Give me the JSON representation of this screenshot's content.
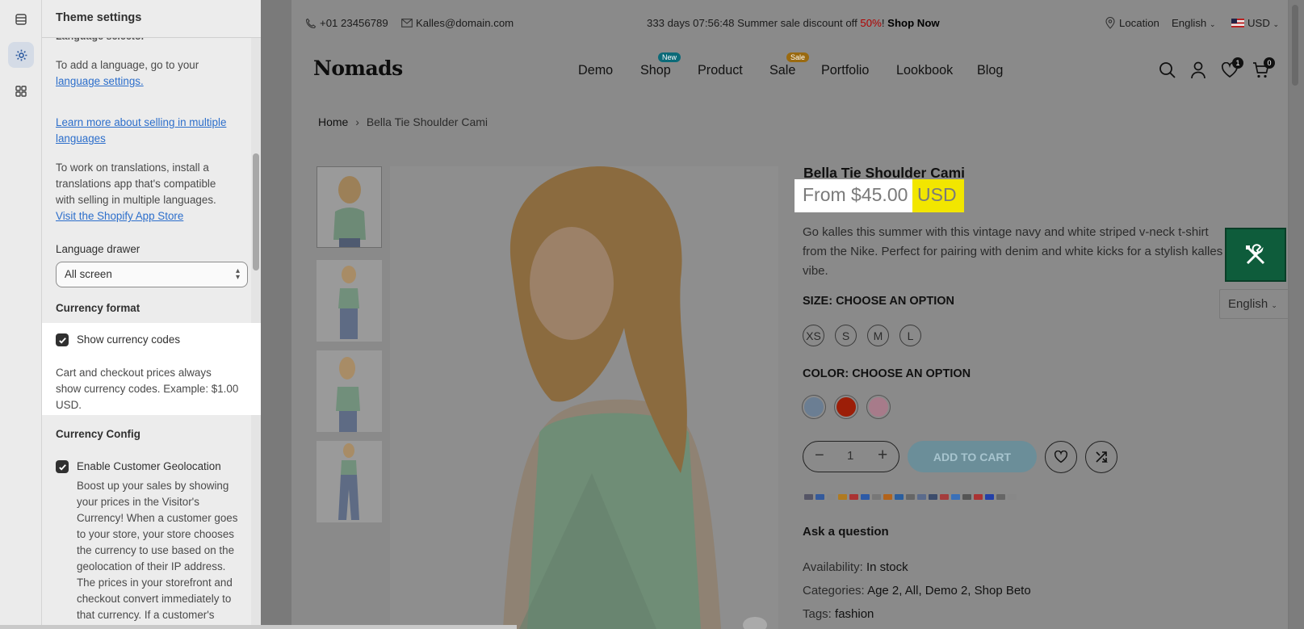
{
  "sidebar": {
    "title": "Theme settings",
    "cut_heading": "Language selector",
    "add_language_text": "To add a language, go to your",
    "add_language_link": "language settings.",
    "learn_more_link_line1": "Learn more about selling in multiple",
    "learn_more_link_line2": "languages",
    "translations_text_line1": "To work on translations, install a",
    "translations_text_line2": "translations app that's compatible",
    "translations_text_line3": "with selling in multiple languages.",
    "app_store_link": "Visit the Shopify App Store",
    "language_drawer_label": "Language drawer",
    "language_drawer_value": "All screen",
    "currency_format_heading": "Currency format",
    "show_currency_codes_label": "Show currency codes",
    "show_currency_codes_checked": true,
    "currency_help_line1": "Cart and checkout prices always",
    "currency_help_line2": "show currency codes. Example: $1.00",
    "currency_help_line3": "USD.",
    "currency_config_heading": "Currency Config",
    "geolocation_label": "Enable Customer Geolocation",
    "geolocation_checked": true,
    "geo_desc": [
      "Boost up your sales by showing",
      "your prices in the Visitor's",
      "Currency! When a customer goes",
      "to your store, your store chooses",
      "the currency to use based on the",
      "geolocation of their IP address.",
      "The prices in your storefront and",
      "checkout convert immediately to",
      "that currency. If a customer's"
    ]
  },
  "store": {
    "topbar": {
      "phone": "+01 23456789",
      "email": "Kalles@domain.com",
      "promo_countdown": "333 days 07:56:48 Summer sale discount off",
      "promo_percent": "50%",
      "promo_bang": "!",
      "promo_link": "Shop Now",
      "location": "Location",
      "language": "English",
      "currency": "USD"
    },
    "logo": "Nomads",
    "nav": {
      "demo": "Demo",
      "shop": "Shop",
      "shop_badge": "New",
      "product": "Product",
      "sale": "Sale",
      "sale_badge": "Sale",
      "portfolio": "Portfolio",
      "lookbook": "Lookbook",
      "blog": "Blog"
    },
    "wishlist_count": "1",
    "cart_count": "0",
    "breadcrumb": {
      "home": "Home",
      "separator": "›",
      "current": "Bella Tie Shoulder Cami"
    },
    "product": {
      "title": "Bella Tie Shoulder Cami",
      "price": "From $45.00",
      "currency_code": "USD",
      "desc_line1": "Go kalles this summer with this vintage navy and white striped v-neck t-shirt",
      "desc_line2": "from the Nike. Perfect for pairing with denim and white kicks for a stylish kalles",
      "desc_line3": "vibe.",
      "size_label": "SIZE: CHOOSE AN OPTION",
      "sizes": [
        "XS",
        "S",
        "M",
        "L"
      ],
      "color_label": "COLOR: CHOOSE AN OPTION",
      "colors": [
        "#6b7e93",
        "#9c1e08",
        "#a77b8a"
      ],
      "quantity": "1",
      "add_to_cart": "ADD TO CART",
      "ask_question": "Ask a question",
      "availability_label": "Availability:",
      "availability_value": "In stock",
      "categories_label": "Categories:",
      "categories_value": "Age 2, All, Demo 2, Shop Beto",
      "tags_label": "Tags:",
      "tags_value": "fashion"
    },
    "floating_language": "English"
  },
  "colors": {
    "panel_bg": "#ececec",
    "link": "#2c6ecb",
    "highlight_yellow": "#f2e600",
    "tool_button": "#0e5c3b",
    "sale_price": "#b00000"
  }
}
